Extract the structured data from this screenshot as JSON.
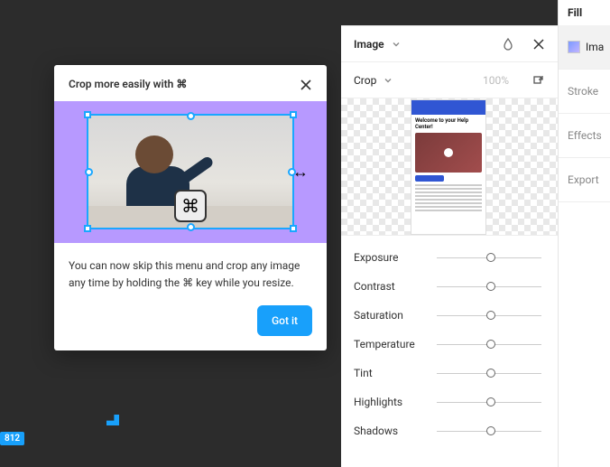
{
  "tooltip": {
    "title": "Crop more easily with ⌘",
    "body": "You can now skip this menu and crop any image any time by holding the ⌘ key while you resize.",
    "button": "Got it",
    "cmd_glyph": "⌘",
    "arrow_glyph": "↔"
  },
  "image_panel": {
    "header_label": "Image",
    "mode_label": "Crop",
    "percent": "100%",
    "thumb_title": "Welcome to your Help Center!",
    "controls": [
      {
        "label": "Exposure",
        "pos": 0.5
      },
      {
        "label": "Contrast",
        "pos": 0.5
      },
      {
        "label": "Saturation",
        "pos": 0.5
      },
      {
        "label": "Temperature",
        "pos": 0.5
      },
      {
        "label": "Tint",
        "pos": 0.5
      },
      {
        "label": "Highlights",
        "pos": 0.5
      },
      {
        "label": "Shadows",
        "pos": 0.5
      }
    ]
  },
  "right_bar": {
    "section": "Fill",
    "active_label": "Ima",
    "items": [
      "Stroke",
      "Effects",
      "Export"
    ]
  },
  "corner": {
    "badge": "812"
  }
}
